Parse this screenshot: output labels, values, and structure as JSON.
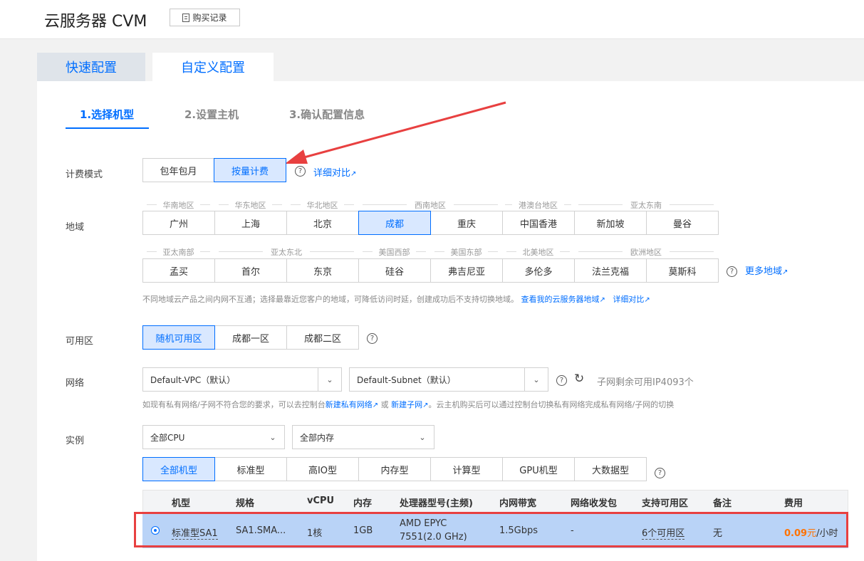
{
  "header": {
    "title": "云服务器 CVM",
    "purchase_button": "购买记录"
  },
  "tabs": [
    {
      "label": "快速配置"
    },
    {
      "label": "自定义配置"
    }
  ],
  "steps": [
    {
      "label": "1.选择机型"
    },
    {
      "label": "2.设置主机"
    },
    {
      "label": "3.确认配置信息"
    }
  ],
  "billing": {
    "label": "计费模式",
    "options": [
      "包年包月",
      "按量计费"
    ],
    "selected": "按量计费",
    "compare_link": "详细对比"
  },
  "region": {
    "label": "地域",
    "row1_groups": [
      "华南地区",
      "华东地区",
      "华北地区",
      "西南地区",
      "港澳台地区",
      "亚太东南"
    ],
    "row1": [
      "广州",
      "上海",
      "北京",
      "成都",
      "重庆",
      "中国香港",
      "新加坡",
      "曼谷"
    ],
    "row2_groups": [
      "亚太南部",
      "亚太东北",
      "美国西部",
      "美国东部",
      "北美地区",
      "欧洲地区"
    ],
    "row2": [
      "孟买",
      "首尔",
      "东京",
      "硅谷",
      "弗吉尼亚",
      "多伦多",
      "法兰克福",
      "莫斯科"
    ],
    "selected": "成都",
    "more_link": "更多地域",
    "hint": "不同地域云产品之间内网不互通；选择最靠近您客户的地域，可降低访问时延，创建成功后不支持切换地域。",
    "hint_link1": "查看我的云服务器地域",
    "hint_link2": "详细对比"
  },
  "zone": {
    "label": "可用区",
    "options": [
      "随机可用区",
      "成都一区",
      "成都二区"
    ],
    "selected": "随机可用区"
  },
  "network": {
    "label": "网络",
    "vpc": "Default-VPC（默认）",
    "subnet": "Default-Subnet（默认）",
    "ip_remaining": "子网剩余可用IP4093个",
    "hint_pre": "如现有私有网络/子网不符合您的要求，可以去控制台",
    "hint_link1": "新建私有网络",
    "hint_mid": "或",
    "hint_link2": "新建子网",
    "hint_post": "。云主机购买后可以通过控制台切换私有网络完成私有网络/子网的切换"
  },
  "instance": {
    "label": "实例",
    "cpu_select": "全部CPU",
    "mem_select": "全部内存",
    "types": [
      "全部机型",
      "标准型",
      "高IO型",
      "内存型",
      "计算型",
      "GPU机型",
      "大数据型"
    ],
    "selected_type": "全部机型",
    "columns": [
      "机型",
      "规格",
      "vCPU",
      "内存",
      "处理器型号(主频)",
      "内网带宽",
      "网络收发包",
      "支持可用区",
      "备注",
      "费用"
    ],
    "row": {
      "type": "标准型SA1",
      "spec": "SA1.SMA...",
      "vcpu": "1核",
      "memory": "1GB",
      "cpu_line1": "AMD EPYC",
      "cpu_line2": "7551(2.0 GHz)",
      "bandwidth": "1.5Gbps",
      "pps": "-",
      "zones": "6个可用区",
      "note": "无",
      "price": "0.09",
      "price_unit": "元",
      "price_suffix": "/小时"
    }
  },
  "colors": {
    "accent": "#006eff",
    "price": "#ff7200",
    "annotation": "#e84040"
  }
}
